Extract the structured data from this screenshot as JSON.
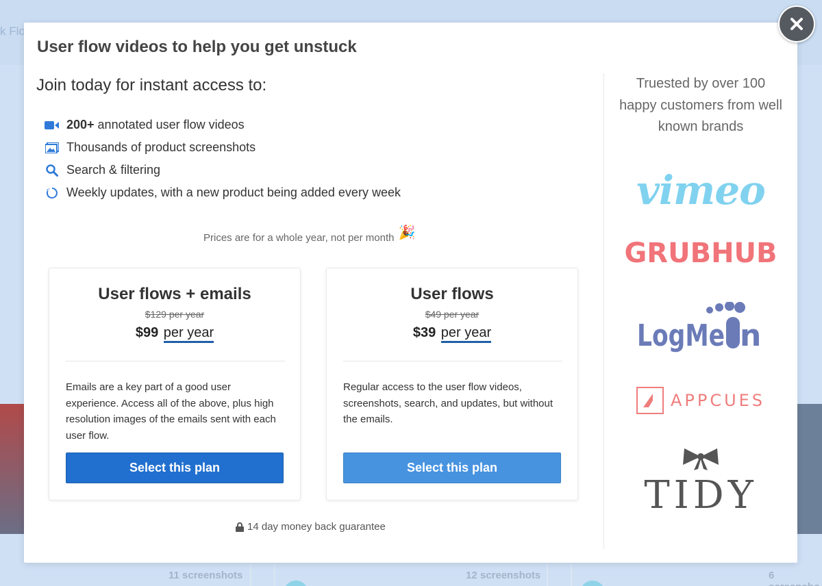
{
  "background": {
    "crumb": "k Flo",
    "counts": [
      "11 screenshots",
      "12 screenshots",
      "6 screensho"
    ]
  },
  "modal": {
    "title": "User flow videos to help you get unstuck",
    "intro": "Join today for instant access to:",
    "features": [
      {
        "icon": "video-camera-icon",
        "bold": "200+",
        "text": "annotated user flow videos"
      },
      {
        "icon": "image-gallery-icon",
        "bold": "",
        "text": "Thousands of product screenshots"
      },
      {
        "icon": "search-icon",
        "bold": "",
        "text": "Search & filtering"
      },
      {
        "icon": "refresh-circle-icon",
        "bold": "",
        "text": "Weekly updates, with a new product being added every week"
      }
    ],
    "price_note": "Prices are for a whole year, not per month",
    "plans": [
      {
        "name": "User flows + emails",
        "old_price": "$129 per year",
        "price": "$99",
        "period": "per year",
        "description": "Emails are a key part of a good user experience. Access all of the above, plus high resolution images of the emails sent with each user flow.",
        "button": "Select this plan"
      },
      {
        "name": "User flows",
        "old_price": "$49 per year",
        "price": "$39",
        "period": "per year",
        "description": "Regular access to the user flow videos, screenshots, search, and updates, but without the emails.",
        "button": "Select this plan"
      }
    ],
    "guarantee": "14 day money back guarantee",
    "trusted": "Truested by over 100 happy customers from well known brands",
    "logos": {
      "vimeo": "vimeo",
      "grubhub": "GRUBHUB",
      "logmein": "LogMeIn",
      "appcues": "APPCUES",
      "tidy": "TIDY"
    },
    "colors": {
      "primary_button": "#2170cf",
      "secondary_button": "#4793e0",
      "vimeo": "#80d2ef",
      "grubhub": "#f07479",
      "logmein": "#6b7bb8",
      "appcues": "#ef7d7d",
      "tidy": "#555555"
    }
  }
}
